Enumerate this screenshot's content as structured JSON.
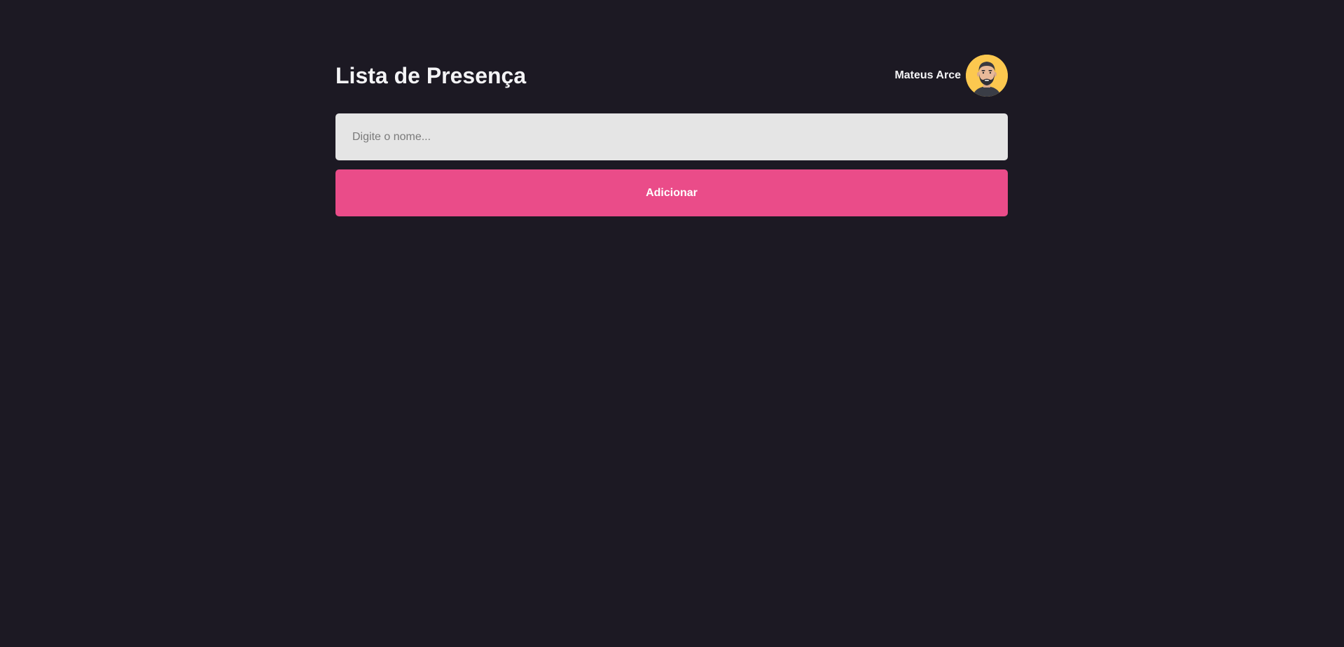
{
  "header": {
    "title": "Lista de Presença",
    "user": {
      "name": "Mateus Arce",
      "avatar_icon": "user-avatar-bearded-man",
      "avatar_bg": "#fcc84f"
    }
  },
  "form": {
    "name_input": {
      "value": "",
      "placeholder": "Digite o nome..."
    },
    "add_button_label": "Adicionar"
  },
  "students": [],
  "colors": {
    "background": "#1c1923",
    "accent": "#ea4c89",
    "input_bg": "#e5e5e5",
    "text": "#ffffff"
  }
}
